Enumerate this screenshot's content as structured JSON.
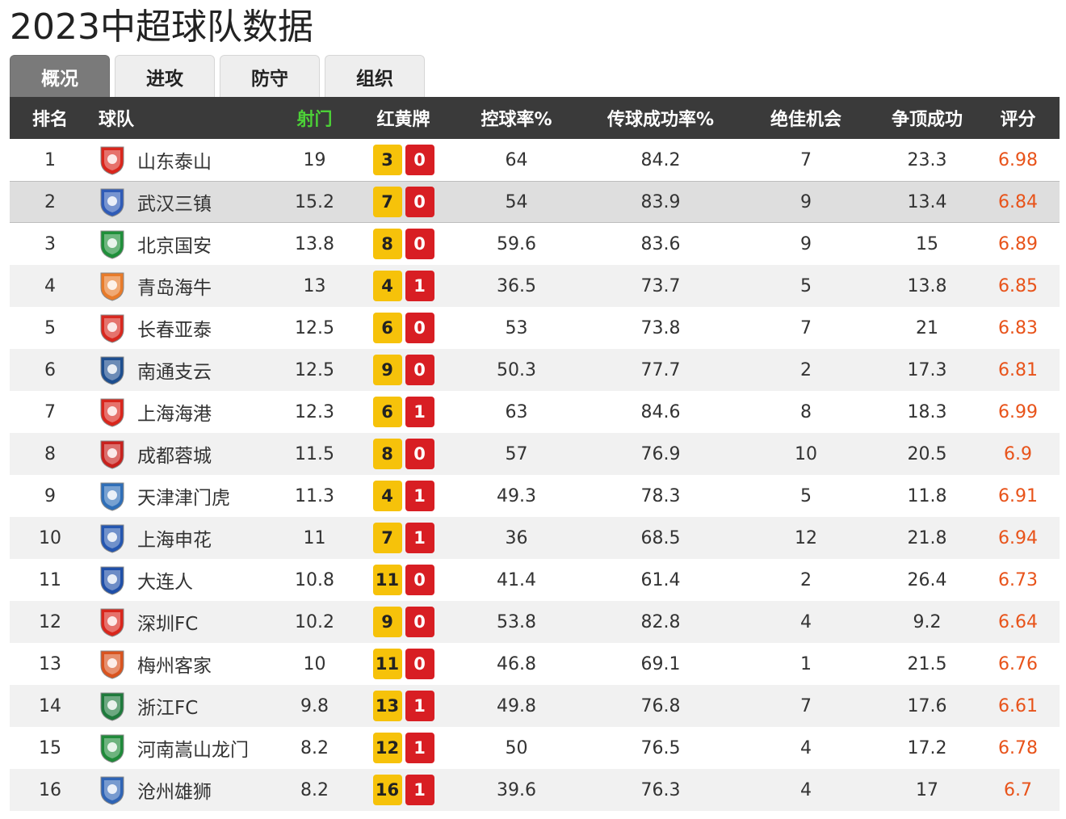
{
  "title": "2023中超球队数据",
  "tabs": [
    {
      "label": "概况",
      "active": true
    },
    {
      "label": "进攻",
      "active": false
    },
    {
      "label": "防守",
      "active": false
    },
    {
      "label": "组织",
      "active": false
    }
  ],
  "columns": {
    "rank": "排名",
    "team": "球队",
    "shots": "射门",
    "cards": "红黄牌",
    "possession": "控球率%",
    "pass_accuracy": "传球成功率%",
    "big_chances": "绝佳机会",
    "aerials_won": "争顶成功",
    "rating": "评分"
  },
  "colors": {
    "header_bg": "#3a3a3a",
    "sorted_header": "#4cd137",
    "yellow_card": "#f6c20a",
    "red_card": "#d81e23",
    "rating": "#e8531a"
  },
  "rows": [
    {
      "rank": "1",
      "team": "山东泰山",
      "shots": "19",
      "yellow": "3",
      "red": "0",
      "possession": "64",
      "pass_accuracy": "84.2",
      "big_chances": "7",
      "aerials_won": "23.3",
      "rating": "6.98",
      "logo_icon": "shandong-taishan-logo-icon",
      "logo_color": "#d9261c"
    },
    {
      "rank": "2",
      "team": "武汉三镇",
      "shots": "15.2",
      "yellow": "7",
      "red": "0",
      "possession": "54",
      "pass_accuracy": "83.9",
      "big_chances": "9",
      "aerials_won": "13.4",
      "rating": "6.84",
      "logo_icon": "wuhan-sanzhen-logo-icon",
      "logo_color": "#2f5bb7"
    },
    {
      "rank": "3",
      "team": "北京国安",
      "shots": "13.8",
      "yellow": "8",
      "red": "0",
      "possession": "59.6",
      "pass_accuracy": "83.6",
      "big_chances": "9",
      "aerials_won": "15",
      "rating": "6.89",
      "logo_icon": "beijing-guoan-logo-icon",
      "logo_color": "#1f8f3a"
    },
    {
      "rank": "4",
      "team": "青岛海牛",
      "shots": "13",
      "yellow": "4",
      "red": "1",
      "possession": "36.5",
      "pass_accuracy": "73.7",
      "big_chances": "5",
      "aerials_won": "13.8",
      "rating": "6.85",
      "logo_icon": "qingdao-hainiu-logo-icon",
      "logo_color": "#e87b2a"
    },
    {
      "rank": "5",
      "team": "长春亚泰",
      "shots": "12.5",
      "yellow": "6",
      "red": "0",
      "possession": "53",
      "pass_accuracy": "73.8",
      "big_chances": "7",
      "aerials_won": "21",
      "rating": "6.83",
      "logo_icon": "changchun-yatai-logo-icon",
      "logo_color": "#d8281f"
    },
    {
      "rank": "6",
      "team": "南通支云",
      "shots": "12.5",
      "yellow": "9",
      "red": "0",
      "possession": "50.3",
      "pass_accuracy": "77.7",
      "big_chances": "2",
      "aerials_won": "17.3",
      "rating": "6.81",
      "logo_icon": "nantong-zhiyun-logo-icon",
      "logo_color": "#1d4e8f"
    },
    {
      "rank": "7",
      "team": "上海海港",
      "shots": "12.3",
      "yellow": "6",
      "red": "1",
      "possession": "63",
      "pass_accuracy": "84.6",
      "big_chances": "8",
      "aerials_won": "18.3",
      "rating": "6.99",
      "logo_icon": "shanghai-haigang-logo-icon",
      "logo_color": "#d9261c"
    },
    {
      "rank": "8",
      "team": "成都蓉城",
      "shots": "11.5",
      "yellow": "8",
      "red": "0",
      "possession": "57",
      "pass_accuracy": "76.9",
      "big_chances": "10",
      "aerials_won": "20.5",
      "rating": "6.9",
      "logo_icon": "chengdu-rongcheng-logo-icon",
      "logo_color": "#c8211d"
    },
    {
      "rank": "9",
      "team": "天津津门虎",
      "shots": "11.3",
      "yellow": "4",
      "red": "1",
      "possession": "49.3",
      "pass_accuracy": "78.3",
      "big_chances": "5",
      "aerials_won": "11.8",
      "rating": "6.91",
      "logo_icon": "tianjin-jinmenhu-logo-icon",
      "logo_color": "#2f6fb8"
    },
    {
      "rank": "10",
      "team": "上海申花",
      "shots": "11",
      "yellow": "7",
      "red": "1",
      "possession": "36",
      "pass_accuracy": "68.5",
      "big_chances": "12",
      "aerials_won": "21.8",
      "rating": "6.94",
      "logo_icon": "shanghai-shenhua-logo-icon",
      "logo_color": "#2456b0"
    },
    {
      "rank": "11",
      "team": "大连人",
      "shots": "10.8",
      "yellow": "11",
      "red": "0",
      "possession": "41.4",
      "pass_accuracy": "61.4",
      "big_chances": "2",
      "aerials_won": "26.4",
      "rating": "6.73",
      "logo_icon": "dalian-ren-logo-icon",
      "logo_color": "#1f4fa8"
    },
    {
      "rank": "12",
      "team": "深圳FC",
      "shots": "10.2",
      "yellow": "9",
      "red": "0",
      "possession": "53.8",
      "pass_accuracy": "82.8",
      "big_chances": "4",
      "aerials_won": "9.2",
      "rating": "6.64",
      "logo_icon": "shenzhen-fc-logo-icon",
      "logo_color": "#d9261c"
    },
    {
      "rank": "13",
      "team": "梅州客家",
      "shots": "10",
      "yellow": "11",
      "red": "0",
      "possession": "46.8",
      "pass_accuracy": "69.1",
      "big_chances": "1",
      "aerials_won": "21.5",
      "rating": "6.76",
      "logo_icon": "meizhou-hakka-logo-icon",
      "logo_color": "#d9541f"
    },
    {
      "rank": "14",
      "team": "浙江FC",
      "shots": "9.8",
      "yellow": "13",
      "red": "1",
      "possession": "49.8",
      "pass_accuracy": "76.8",
      "big_chances": "7",
      "aerials_won": "17.6",
      "rating": "6.61",
      "logo_icon": "zhejiang-fc-logo-icon",
      "logo_color": "#1e7a3c"
    },
    {
      "rank": "15",
      "team": "河南嵩山龙门",
      "shots": "8.2",
      "yellow": "12",
      "red": "1",
      "possession": "50",
      "pass_accuracy": "76.5",
      "big_chances": "4",
      "aerials_won": "17.2",
      "rating": "6.78",
      "logo_icon": "henan-songshan-longmen-logo-icon",
      "logo_color": "#1f8a3a"
    },
    {
      "rank": "16",
      "team": "沧州雄狮",
      "shots": "8.2",
      "yellow": "16",
      "red": "1",
      "possession": "39.6",
      "pass_accuracy": "76.3",
      "big_chances": "4",
      "aerials_won": "17",
      "rating": "6.7",
      "logo_icon": "cangzhou-xiongshi-logo-icon",
      "logo_color": "#2f64b5"
    }
  ]
}
